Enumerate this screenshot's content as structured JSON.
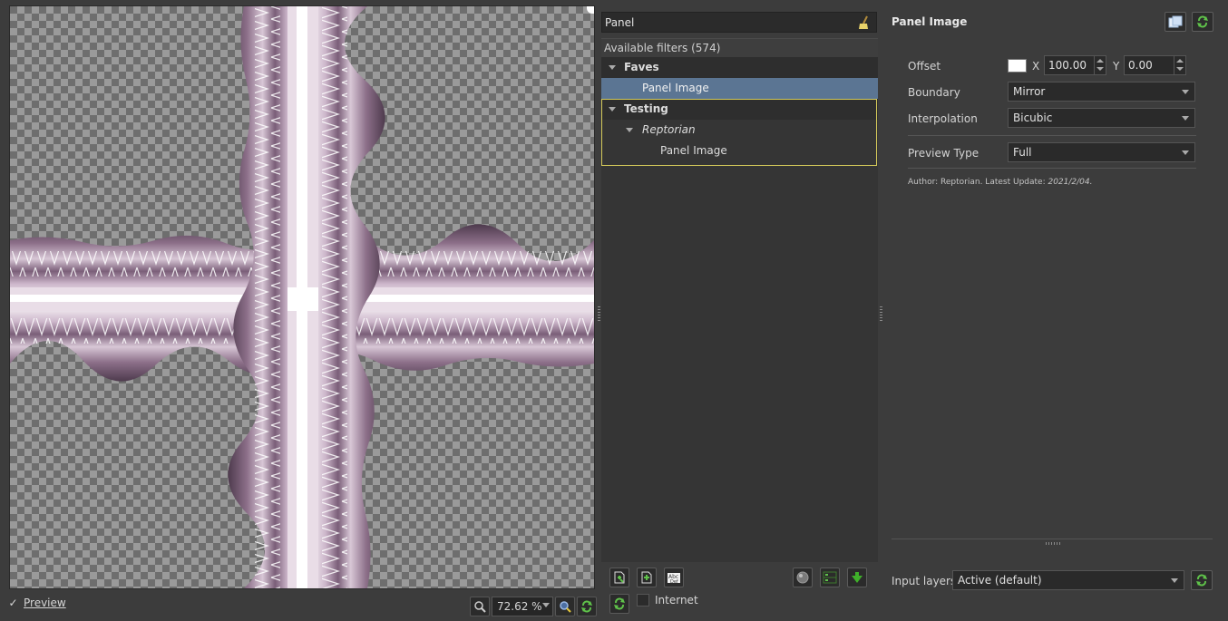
{
  "preview": {
    "checkbox_label": "Preview",
    "checked": true,
    "zoom_value": "72.62 %"
  },
  "filters": {
    "search_value": "Panel",
    "available_label": "Available filters (574)",
    "tree": [
      {
        "label": "Faves",
        "style": "bold"
      },
      {
        "label": "Panel Image",
        "selected": true
      },
      {
        "label": "Testing",
        "style": "bold"
      },
      {
        "label": "Reptorian",
        "style": "italic"
      },
      {
        "label": "Panel Image"
      }
    ],
    "internet_label": "Internet"
  },
  "params": {
    "title": "Panel Image",
    "offset": {
      "label": "Offset",
      "x_label": "X",
      "x_value": "100.00",
      "y_label": "Y",
      "y_value": "0.00",
      "swatch_color": "#ffffff"
    },
    "boundary": {
      "label": "Boundary",
      "value": "Mirror"
    },
    "interpolation": {
      "label": "Interpolation",
      "value": "Bicubic"
    },
    "preview_type": {
      "label": "Preview Type",
      "value": "Full"
    },
    "author_prefix": "Author: Reptorian. Latest Update: ",
    "author_date": "2021/2/04.",
    "input_layers": {
      "label": "Input layers",
      "value": "Active (default)"
    }
  },
  "colors": {
    "selection": "#5b7593",
    "highlight_border": "#d4c95a",
    "panel_light": "#f2e6f0",
    "panel_mid": "#b59bb2",
    "panel_dark": "#6b4f69",
    "checker_a": "#9a9a9a",
    "checker_b": "#6e6e6e"
  }
}
